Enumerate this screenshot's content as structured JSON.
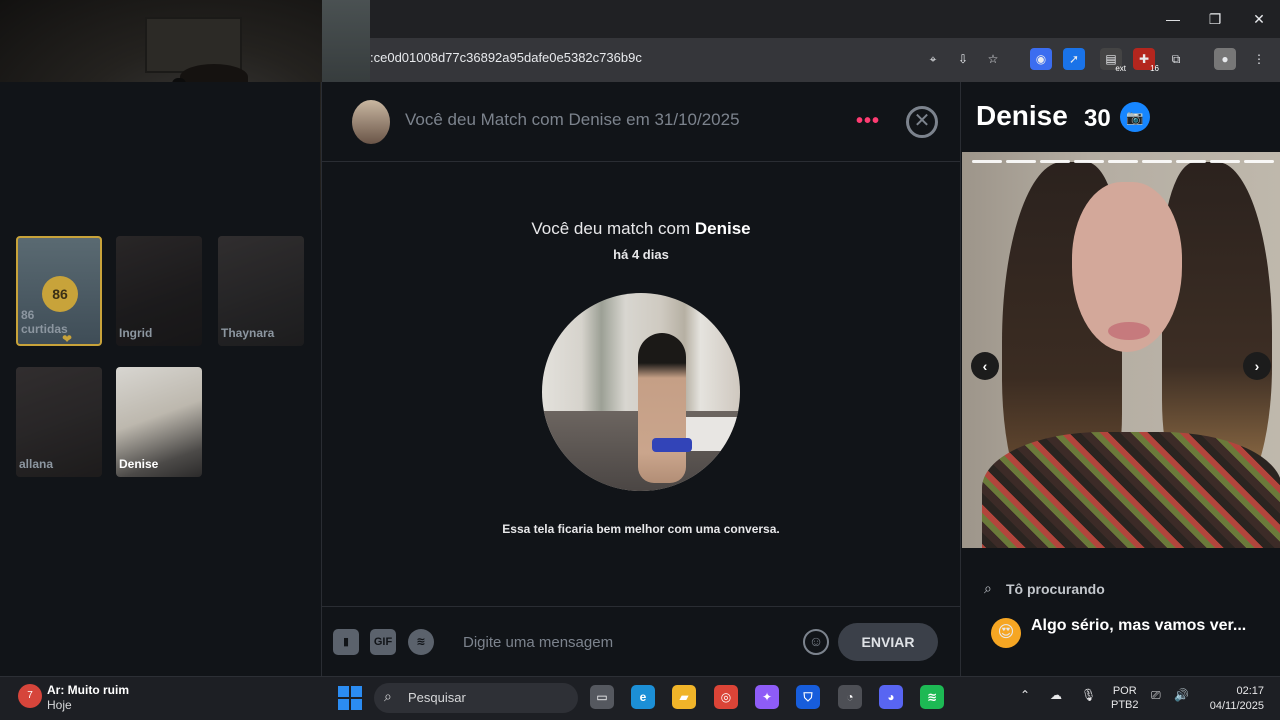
{
  "browser": {
    "url": ":ce0d01008d77c36892a95dafe0e5382c736b9c",
    "extensions": [
      {
        "name": "location-icon",
        "glyph": "⌖"
      },
      {
        "name": "install-icon",
        "glyph": "⇩"
      },
      {
        "name": "bookmark-star-icon",
        "glyph": "☆"
      },
      {
        "name": "extension-blue-icon",
        "glyph": "◉"
      },
      {
        "name": "extension-arrow-icon",
        "glyph": "➚"
      },
      {
        "name": "extension-ext-icon",
        "glyph": "▤",
        "badge": "ext"
      },
      {
        "name": "extension-red-icon",
        "glyph": "✚",
        "badge": "16"
      },
      {
        "name": "puzzle-icon",
        "glyph": "⧉"
      },
      {
        "name": "profile-icon",
        "glyph": "●"
      },
      {
        "name": "menu-icon",
        "glyph": "⋮"
      }
    ],
    "window_controls": {
      "minimize": "—",
      "restore": "❐",
      "close": "✕"
    }
  },
  "sidebar": {
    "likes_card": {
      "count": "86",
      "caption_line1": "86",
      "caption_line2": "curtidas"
    },
    "matches": [
      {
        "name": "Ingrid"
      },
      {
        "name": "Thaynara"
      },
      {
        "name": "allana"
      },
      {
        "name": "Denise"
      }
    ]
  },
  "chat": {
    "header_text": "Você deu Match com Denise em 31/10/2025",
    "more_icon": "•••",
    "close_icon": "✕",
    "title_prefix": "Você deu match com",
    "title_name": "Denise",
    "ago": "há 4 dias",
    "hint": "Essa tela ficaria bem melhor com uma conversa.",
    "composer": {
      "gif_label": "GIF",
      "placeholder": "Digite uma mensagem",
      "emoji_icon": "☺",
      "send_label": "ENVIAR"
    }
  },
  "profile": {
    "name": "Denise",
    "age": "30",
    "verified_icon": "📷",
    "prev_arrow": "‹",
    "next_arrow": "›",
    "photo_count": 9,
    "section_label": "Tô procurando",
    "goal_emoji": "😍",
    "goal_text": "Algo sério, mas vamos ver..."
  },
  "taskbar": {
    "weather_badge": "7",
    "weather_text": "Ar: Muito ruim",
    "weather_day": "Hoje",
    "search_label": "Pesquisar",
    "apps": [
      {
        "name": "task-view-icon",
        "glyph": "▭",
        "color": "#55585f"
      },
      {
        "name": "edge-icon",
        "glyph": "e",
        "color": "#1c8fd6"
      },
      {
        "name": "file-explorer-icon",
        "glyph": "▰",
        "color": "#f0b429"
      },
      {
        "name": "chrome-icon",
        "glyph": "◎",
        "color": "#db4437"
      },
      {
        "name": "copilot-icon",
        "glyph": "✦",
        "color": "#8e5cf7"
      },
      {
        "name": "bitwarden-icon",
        "glyph": "⛉",
        "color": "#175ddc"
      },
      {
        "name": "app-red-icon",
        "glyph": "◔",
        "color": "#4d4f55"
      },
      {
        "name": "discord-icon",
        "glyph": "◕",
        "color": "#5865f2"
      },
      {
        "name": "spotify-icon",
        "glyph": "≋",
        "color": "#1db954"
      }
    ],
    "tray_icons": [
      "⌃",
      "☁",
      "🎙"
    ],
    "lang_line1": "POR",
    "lang_line2": "PTB2",
    "time": "02:17",
    "date": "04/11/2025"
  }
}
